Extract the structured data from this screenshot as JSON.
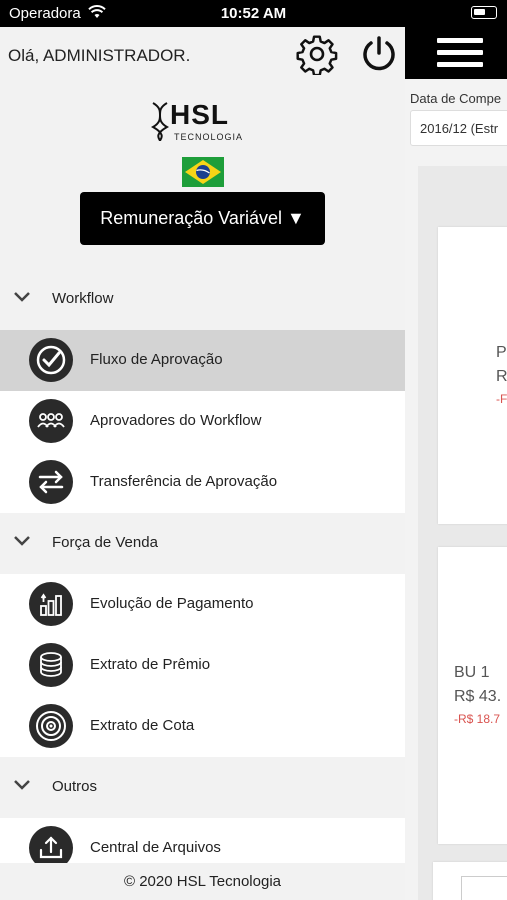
{
  "status_bar": {
    "carrier": "Operadora",
    "time": "10:52 AM"
  },
  "header": {
    "greeting": "Olá, ADMINISTRADOR."
  },
  "logo": {
    "text": "HSL",
    "subtext": "TECNOLOGIA"
  },
  "module_selector": {
    "label": "Remuneração Variável ▼"
  },
  "menu": {
    "sections": [
      {
        "title": "Workflow",
        "items": [
          {
            "label": "Fluxo de Aprovação",
            "icon": "check-circle-icon",
            "active": true
          },
          {
            "label": "Aprovadores do Workflow",
            "icon": "people-group-icon"
          },
          {
            "label": "Transferência de Aprovação",
            "icon": "transfer-arrows-icon"
          }
        ]
      },
      {
        "title": "Força de Venda",
        "items": [
          {
            "label": "Evolução de Pagamento",
            "icon": "bar-growth-icon"
          },
          {
            "label": "Extrato de Prêmio",
            "icon": "coins-stack-icon"
          },
          {
            "label": "Extrato de Cota",
            "icon": "target-icon"
          }
        ]
      },
      {
        "title": "Outros",
        "items": [
          {
            "label": "Central de Arquivos",
            "icon": "upload-tray-icon"
          }
        ]
      }
    ]
  },
  "footer": {
    "text": "© 2020 HSL Tecnologia"
  },
  "background": {
    "competence_label": "Data de Compe",
    "competence_value": "2016/12 (Estr",
    "card1": {
      "line1": "P",
      "line2": "R",
      "line3": "-F"
    },
    "card2": {
      "line1": "BU 1",
      "line2": "R$ 43.",
      "line3": "-R$ 18.7"
    }
  },
  "colors": {
    "header_bg": "#000000",
    "active_item_bg": "#d3d3d3",
    "negative_text": "#d9534f"
  }
}
